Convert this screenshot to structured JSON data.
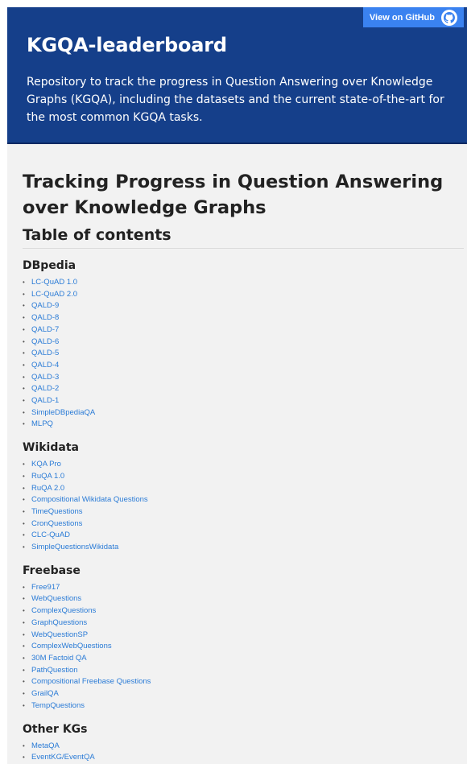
{
  "header": {
    "github_button": "View on GitHub",
    "title": "KGQA-leaderboard",
    "description": "Repository to track the progress in Question Answering over Knowledge Graphs (KGQA), including the datasets and the current state-of-the-art for the most common KGQA tasks."
  },
  "main": {
    "title": "Tracking Progress in Question Answering over Knowledge Graphs",
    "toc_title": "Table of contents",
    "sections": [
      {
        "heading": "DBpedia",
        "items": [
          "LC-QuAD 1.0",
          "LC-QuAD 2.0",
          "QALD-9",
          "QALD-8",
          "QALD-7",
          "QALD-6",
          "QALD-5",
          "QALD-4",
          "QALD-3",
          "QALD-2",
          "QALD-1",
          "SimpleDBpediaQA",
          "MLPQ"
        ]
      },
      {
        "heading": "Wikidata",
        "items": [
          "KQA Pro",
          "RuQA 1.0",
          "RuQA 2.0",
          "Compositional Wikidata Questions",
          "TimeQuestions",
          "CronQuestions",
          "CLC-QuAD",
          "SimpleQuestionsWikidata"
        ]
      },
      {
        "heading": "Freebase",
        "items": [
          "Free917",
          "WebQuestions",
          "ComplexQuestions",
          "GraphQuestions",
          "WebQuestionSP",
          "ComplexWebQuestions",
          "30M Factoid QA",
          "PathQuestion",
          "Compositional Freebase Questions",
          "GrailQA",
          "TempQuestions"
        ]
      },
      {
        "heading": "Other KGs",
        "items": [
          "MetaQA",
          "EventKG/EventQA"
        ]
      }
    ]
  },
  "colors": {
    "header_bg": "#153f8a",
    "button_bg": "#3a82f0",
    "link": "#2a7bd6",
    "page_bg": "#f2f2f2"
  }
}
